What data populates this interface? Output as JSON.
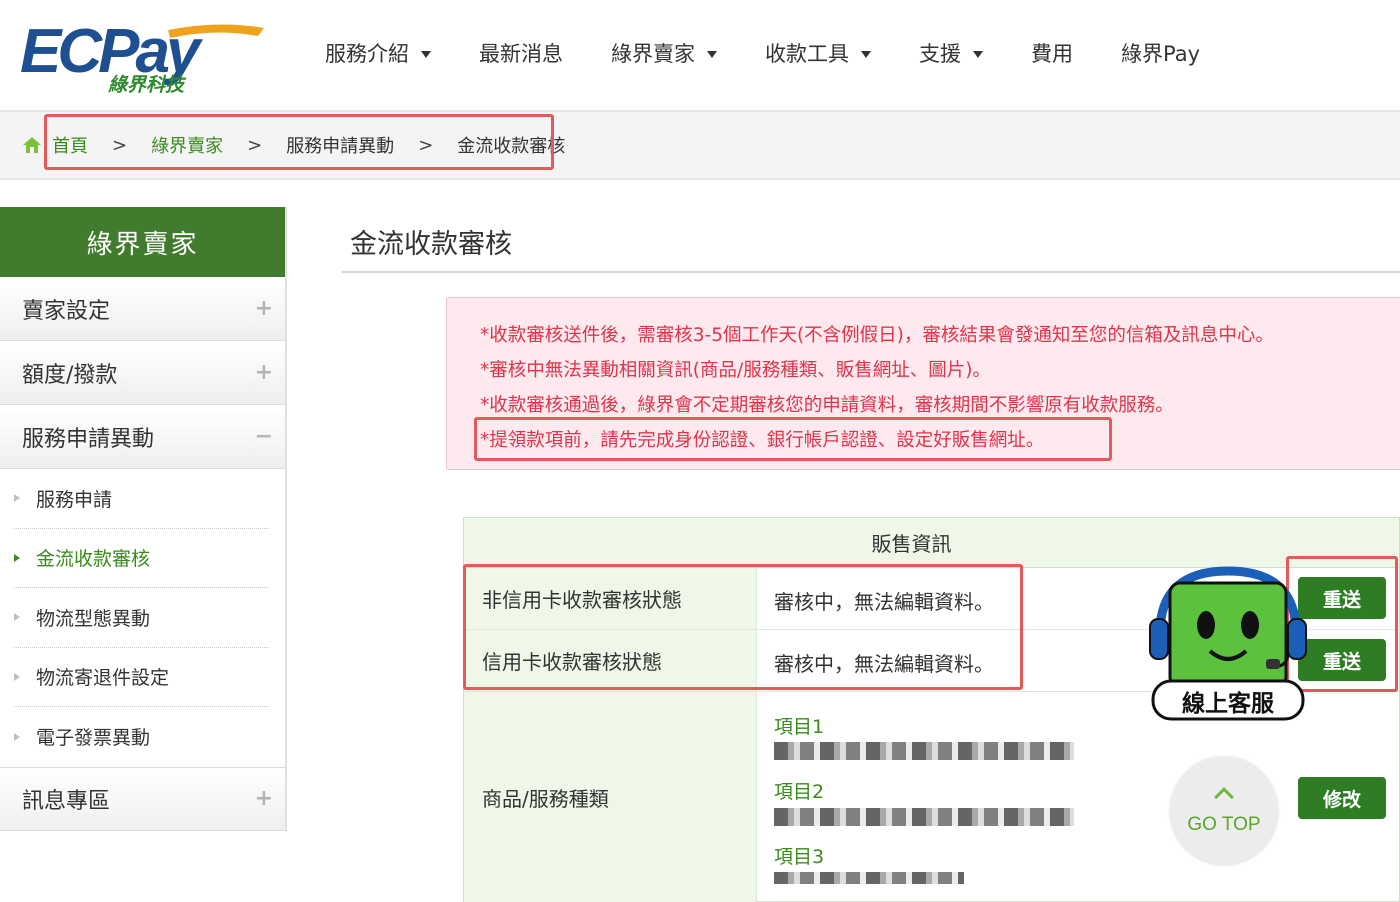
{
  "logo": {
    "brand": "ECPay",
    "subtitle": "綠界科技"
  },
  "nav": [
    {
      "label": "服務介紹",
      "dropdown": true
    },
    {
      "label": "最新消息",
      "dropdown": false
    },
    {
      "label": "綠界賣家",
      "dropdown": true
    },
    {
      "label": "收款工具",
      "dropdown": true
    },
    {
      "label": "支援",
      "dropdown": true
    },
    {
      "label": "費用",
      "dropdown": false
    },
    {
      "label": "綠界Pay",
      "dropdown": false
    }
  ],
  "breadcrumb": {
    "items": [
      "首頁",
      "綠界賣家",
      "服務申請異動",
      "金流收款審核"
    ],
    "separator": ">"
  },
  "sidebar": {
    "title": "綠界賣家",
    "sections": [
      {
        "label": "賣家設定",
        "sign": "+"
      },
      {
        "label": "額度/撥款",
        "sign": "+"
      },
      {
        "label": "服務申請異動",
        "sign": "−"
      }
    ],
    "subitems": [
      "服務申請",
      "金流收款審核",
      "物流型態異動",
      "物流寄退件設定",
      "電子發票異動"
    ],
    "active_subitem": "金流收款審核",
    "bottom_section": {
      "label": "訊息專區",
      "sign": "+"
    }
  },
  "main": {
    "title": "金流收款審核",
    "notices": [
      "*收款審核送件後，需審核3-5個工作天(不含例假日)，審核結果會發通知至您的信箱及訊息中心。",
      "*審核中無法異動相關資訊(商品/服務種類、販售網址、圖片)。",
      "*收款審核通過後，綠界會不定期審核您的申請資料，審核期間不影響原有收款服務。",
      "*提領款項前，請先完成身份認證、銀行帳戶認證、設定好販售網址。"
    ],
    "table": {
      "header": "販售資訊",
      "rows": [
        {
          "label": "非信用卡收款審核狀態",
          "value": "審核中，無法編輯資料。",
          "button": "重送"
        },
        {
          "label": "信用卡收款審核狀態",
          "value": "審核中，無法編輯資料。",
          "button": "重送"
        },
        {
          "label": "商品/服務種類",
          "items": [
            "項目1",
            "項目2",
            "項目3"
          ],
          "button": "修改"
        }
      ]
    }
  },
  "widgets": {
    "customer_service": "線上客服",
    "go_top": "GO TOP"
  },
  "colors": {
    "brand_green": "#417c2e",
    "link_green": "#3b8a1d",
    "button_green": "#2e7d25",
    "notice_red": "#e0344a",
    "notice_bg": "#fde9ee",
    "annotation_red": "#e25b5b",
    "logo_blue": "#1d4f91",
    "logo_orange": "#f0a21c"
  }
}
